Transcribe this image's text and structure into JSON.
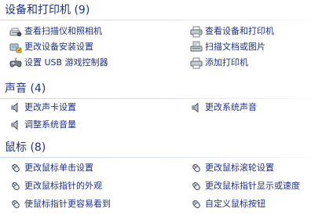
{
  "groups": [
    {
      "title": "设备和打印机 (9)",
      "items": [
        {
          "label": "查看扫描仪和照相机",
          "icon": "scanner-camera-icon"
        },
        {
          "label": "查看设备和打印机",
          "icon": "devices-printers-icon"
        },
        {
          "label": "更改设备安装设置",
          "icon": "device-install-settings-icon"
        },
        {
          "label": "扫描文档或图片",
          "icon": "scan-document-icon"
        },
        {
          "label": "设置 USB 游戏控制器",
          "icon": "game-controller-icon"
        },
        {
          "label": "添加打印机",
          "icon": "add-printer-icon"
        }
      ]
    },
    {
      "title": "声音 (4)",
      "items": [
        {
          "label": "更改声卡设置",
          "icon": "speaker-icon"
        },
        {
          "label": "更改系统声音",
          "icon": "speaker-icon"
        },
        {
          "label": "调整系统音量",
          "icon": "speaker-icon"
        }
      ]
    },
    {
      "title": "鼠标 (8)",
      "items": [
        {
          "label": "更改鼠标单击设置",
          "icon": "mouse-icon"
        },
        {
          "label": "更改鼠标滚轮设置",
          "icon": "mouse-icon"
        },
        {
          "label": "更改鼠标指针的外观",
          "icon": "mouse-icon"
        },
        {
          "label": "更改鼠标指针显示或速度",
          "icon": "mouse-icon"
        },
        {
          "label": "使鼠标指针更容易看到",
          "icon": "mouse-icon"
        },
        {
          "label": "自定义鼠标按钮",
          "icon": "mouse-icon"
        }
      ]
    }
  ],
  "colors": {
    "link": "#1e3287",
    "header": "#1e3287",
    "rule": "#c9d5e8"
  }
}
